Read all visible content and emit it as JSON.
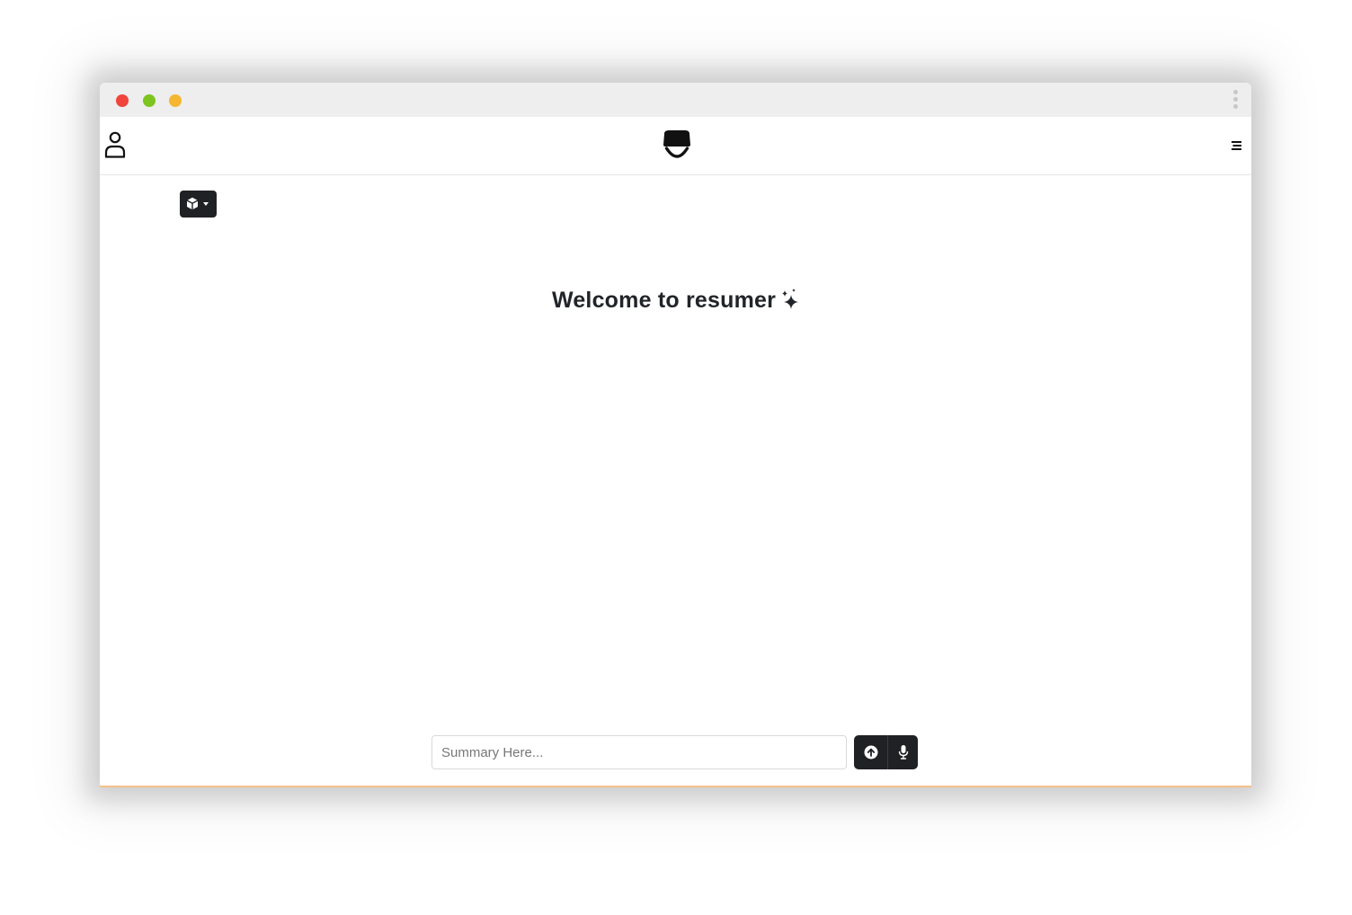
{
  "window": {
    "controls": {
      "close_color": "#f0443c",
      "minimize_color": "#7ec41f",
      "maximize_color": "#f5b731"
    },
    "more_icon": "kebab-vertical-icon"
  },
  "navbar": {
    "profile_icon": "user-icon",
    "logo_icon": "mustache-logo",
    "menu_icon": "hamburger-menu-icon"
  },
  "model_selector": {
    "icon": "cube-icon",
    "caret_icon": "caret-down-icon"
  },
  "main": {
    "welcome_text": "Welcome to resumer",
    "welcome_icon": "sparkles-icon"
  },
  "composer": {
    "placeholder": "Summary Here...",
    "value": "",
    "upload_icon": "upload-arrow-circle-icon",
    "mic_icon": "microphone-icon"
  },
  "colors": {
    "accent_dark": "#1f2124",
    "bottom_border": "#f6c08a"
  }
}
